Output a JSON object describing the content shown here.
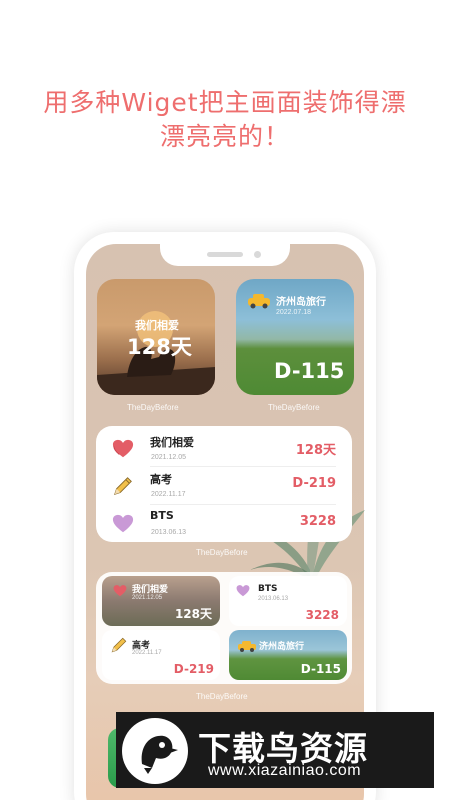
{
  "headline": {
    "line1": "用多种Wiget把主画面装饰得漂",
    "line2": "漂亮亮的！"
  },
  "colors": {
    "accent": "#ee6e6e",
    "value_red": "#e35d66",
    "heart": "#e35d66",
    "purple_heart": "#c999d6"
  },
  "big_widgets": {
    "couple": {
      "title": "我们相爱",
      "value": "128天",
      "brand": "TheDayBefore"
    },
    "jeju": {
      "title": "济州岛旅行",
      "date": "2022.07.18",
      "value": "D-115",
      "brand": "TheDayBefore"
    }
  },
  "list_widget": {
    "rows": [
      {
        "name": "我们相爱",
        "date": "2021.12.05",
        "value": "128天",
        "icon": "heart-icon"
      },
      {
        "name": "高考",
        "date": "2022.11.17",
        "value": "D-219",
        "icon": "pencil-icon"
      },
      {
        "name": "BTS",
        "date": "2013.06.13",
        "value": "3228",
        "icon": "purple-heart-icon"
      }
    ],
    "brand": "TheDayBefore"
  },
  "grid_widget": {
    "cells": [
      {
        "name": "我们相爱",
        "date": "2021.12.05",
        "value": "128天"
      },
      {
        "name": "BTS",
        "date": "2013.06.13",
        "value": "3228"
      },
      {
        "name": "高考",
        "date": "2022.11.17",
        "value": "D-219"
      },
      {
        "name": "济州岛旅行",
        "value": "D-115"
      }
    ],
    "brand": "TheDayBefore"
  },
  "watermark": {
    "title": "下载鸟资源",
    "url": "www.xiazainiao.com"
  }
}
